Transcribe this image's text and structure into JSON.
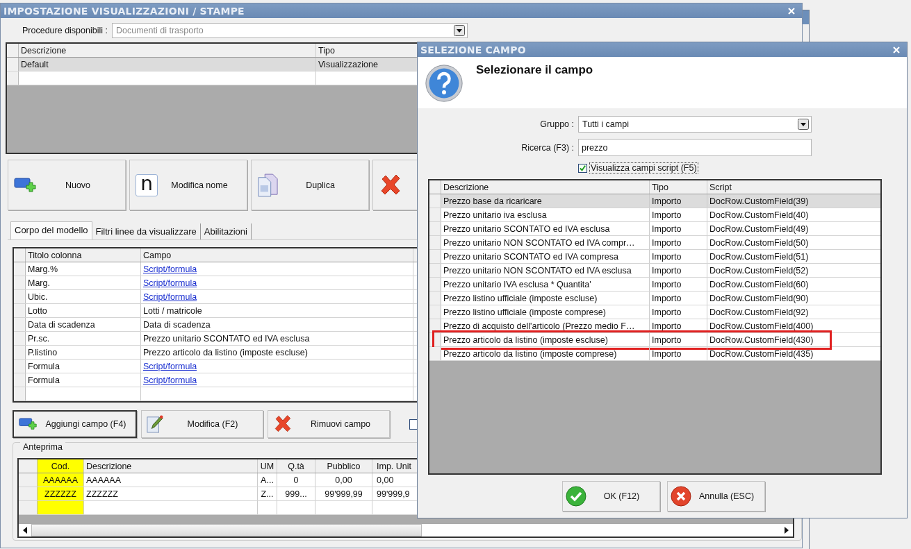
{
  "main_window": {
    "title": "IMPOSTAZIONE VISUALIZZAZIONI / STAMPE",
    "procedure": {
      "label": "Procedure disponibili :",
      "value": "Documenti di trasporto"
    },
    "models_grid": {
      "columns": [
        "Descrizione",
        "Tipo"
      ],
      "rows": [
        {
          "cells": [
            "Default",
            "Visualizzazione"
          ],
          "selected": true
        },
        {
          "cells": [
            "",
            ""
          ],
          "selected": false
        }
      ]
    },
    "toolbar": [
      {
        "kind": "new",
        "label": "Nuovo"
      },
      {
        "kind": "rename",
        "glyph": "n",
        "label": "Modifica nome"
      },
      {
        "kind": "duplicate",
        "label": "Duplica"
      },
      {
        "kind": "delete"
      }
    ],
    "tabs": [
      {
        "label": "Corpo del modello",
        "selected": true
      },
      {
        "label": "Filtri linee da visualizzare",
        "selected": false
      },
      {
        "label": "Abilitazioni",
        "selected": false
      }
    ],
    "fields_grid": {
      "columns": [
        "Titolo colonna",
        "Campo"
      ],
      "rows": [
        {
          "title": "Marg.%",
          "field": "Script/formula",
          "kind": "link"
        },
        {
          "title": "Marg.",
          "field": "Script/formula",
          "kind": "link"
        },
        {
          "title": "Ubic.",
          "field": "Script/formula",
          "kind": "link"
        },
        {
          "title": "Lotto",
          "field": "Lotti / matricole",
          "kind": "text"
        },
        {
          "title": "Data di scadenza",
          "field": "Data di scadenza",
          "kind": "text"
        },
        {
          "title": "Pr.sc.",
          "field": "Prezzo unitario SCONTATO ed IVA esclusa",
          "kind": "text"
        },
        {
          "title": "P.listino",
          "field": "Prezzo articolo da listino (imposte escluse)",
          "kind": "text"
        },
        {
          "title": "Formula",
          "field": "Script/formula",
          "kind": "link"
        },
        {
          "title": "Formula",
          "field": "Script/formula",
          "kind": "link"
        }
      ]
    },
    "field_buttons": [
      {
        "kind": "add",
        "label": "Aggiungi campo (F4)",
        "focused": true
      },
      {
        "kind": "edit",
        "label": "Modifica (F2)",
        "focused": false
      },
      {
        "kind": "remove",
        "label": "Rimuovi campo",
        "focused": false
      }
    ],
    "field_checkbox": {
      "checked": false
    },
    "preview": {
      "title": "Anteprima",
      "columns": [
        "Cod.",
        "Descrizione",
        "UM",
        "Q.tà",
        "Pubblico",
        "Imp. Unit"
      ],
      "rows": [
        [
          "AAAAAA",
          "AAAAAA",
          "A...",
          "0",
          "0,00",
          "0,00"
        ],
        [
          "ZZZZZZ",
          "ZZZZZZ",
          "Z...",
          "999...",
          "99'999,99",
          "99'999,9"
        ],
        [
          "",
          "",
          "",
          "",
          "",
          ""
        ]
      ]
    }
  },
  "dialog": {
    "title": "SELEZIONE CAMPO",
    "heading": "Selezionare il campo",
    "group": {
      "label": "Gruppo :",
      "value": "Tutti i campi"
    },
    "search": {
      "label": "Ricerca (F3) :",
      "value": "prezzo"
    },
    "show_scripts": {
      "label": "Visualizza campi script (F5)",
      "checked": true
    },
    "grid": {
      "columns": [
        "Descrizione",
        "Tipo",
        "Script"
      ],
      "rows": [
        {
          "cells": [
            "Prezzo base da ricaricare",
            "Importo",
            "DocRow.CustomField(39)"
          ],
          "selected": true,
          "highlighted": false
        },
        {
          "cells": [
            "Prezzo unitario iva esclusa",
            "Importo",
            "DocRow.CustomField(40)"
          ],
          "selected": false,
          "highlighted": false
        },
        {
          "cells": [
            "Prezzo unitario SCONTATO ed IVA esclusa",
            "Importo",
            "DocRow.CustomField(49)"
          ],
          "selected": false,
          "highlighted": false
        },
        {
          "cells": [
            "Prezzo unitario NON SCONTATO ed IVA compr…",
            "Importo",
            "DocRow.CustomField(50)"
          ],
          "selected": false,
          "highlighted": false
        },
        {
          "cells": [
            "Prezzo unitario SCONTATO ed IVA compresa",
            "Importo",
            "DocRow.CustomField(51)"
          ],
          "selected": false,
          "highlighted": false
        },
        {
          "cells": [
            "Prezzo unitario NON SCONTATO ed IVA esclusa",
            "Importo",
            "DocRow.CustomField(52)"
          ],
          "selected": false,
          "highlighted": false
        },
        {
          "cells": [
            "Prezzo unitario IVA esclusa * Quantita'",
            "Importo",
            "DocRow.CustomField(60)"
          ],
          "selected": false,
          "highlighted": false
        },
        {
          "cells": [
            "Prezzo listino ufficiale (imposte escluse)",
            "Importo",
            "DocRow.CustomField(90)"
          ],
          "selected": false,
          "highlighted": false
        },
        {
          "cells": [
            "Prezzo listino ufficiale (imposte comprese)",
            "Importo",
            "DocRow.CustomField(92)"
          ],
          "selected": false,
          "highlighted": false
        },
        {
          "cells": [
            "Prezzo di acquisto dell'articolo (Prezzo medio F…",
            "Importo",
            "DocRow.CustomField(400)"
          ],
          "selected": false,
          "highlighted": false
        },
        {
          "cells": [
            "Prezzo articolo da listino (imposte escluse)",
            "Importo",
            "DocRow.CustomField(430)"
          ],
          "selected": false,
          "highlighted": true
        },
        {
          "cells": [
            "Prezzo articolo da listino (imposte comprese)",
            "Importo",
            "DocRow.CustomField(435)"
          ],
          "selected": false,
          "highlighted": false
        }
      ]
    },
    "buttons": [
      {
        "kind": "ok",
        "label": "OK (F12)"
      },
      {
        "kind": "cancel",
        "label": "Annulla (ESC)"
      }
    ]
  }
}
